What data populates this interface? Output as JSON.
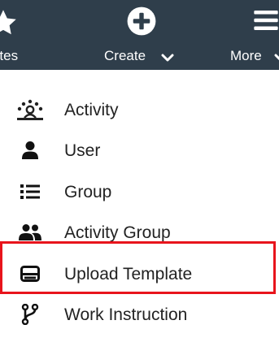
{
  "nav": {
    "favorites_label": "vorites",
    "create_label": "Create",
    "more_label": "More"
  },
  "menu": {
    "items": [
      {
        "label": "Activity",
        "icon": "activity-icon"
      },
      {
        "label": "User",
        "icon": "user-icon"
      },
      {
        "label": "Group",
        "icon": "list-icon"
      },
      {
        "label": "Activity Group",
        "icon": "users-icon"
      },
      {
        "label": "Upload Template",
        "icon": "template-icon"
      },
      {
        "label": "Work Instruction",
        "icon": "branch-icon"
      }
    ]
  },
  "colors": {
    "navbar_bg": "#2f3e4b",
    "nav_text": "#ffffff",
    "menu_text": "#222222",
    "highlight": "#e8141c"
  }
}
